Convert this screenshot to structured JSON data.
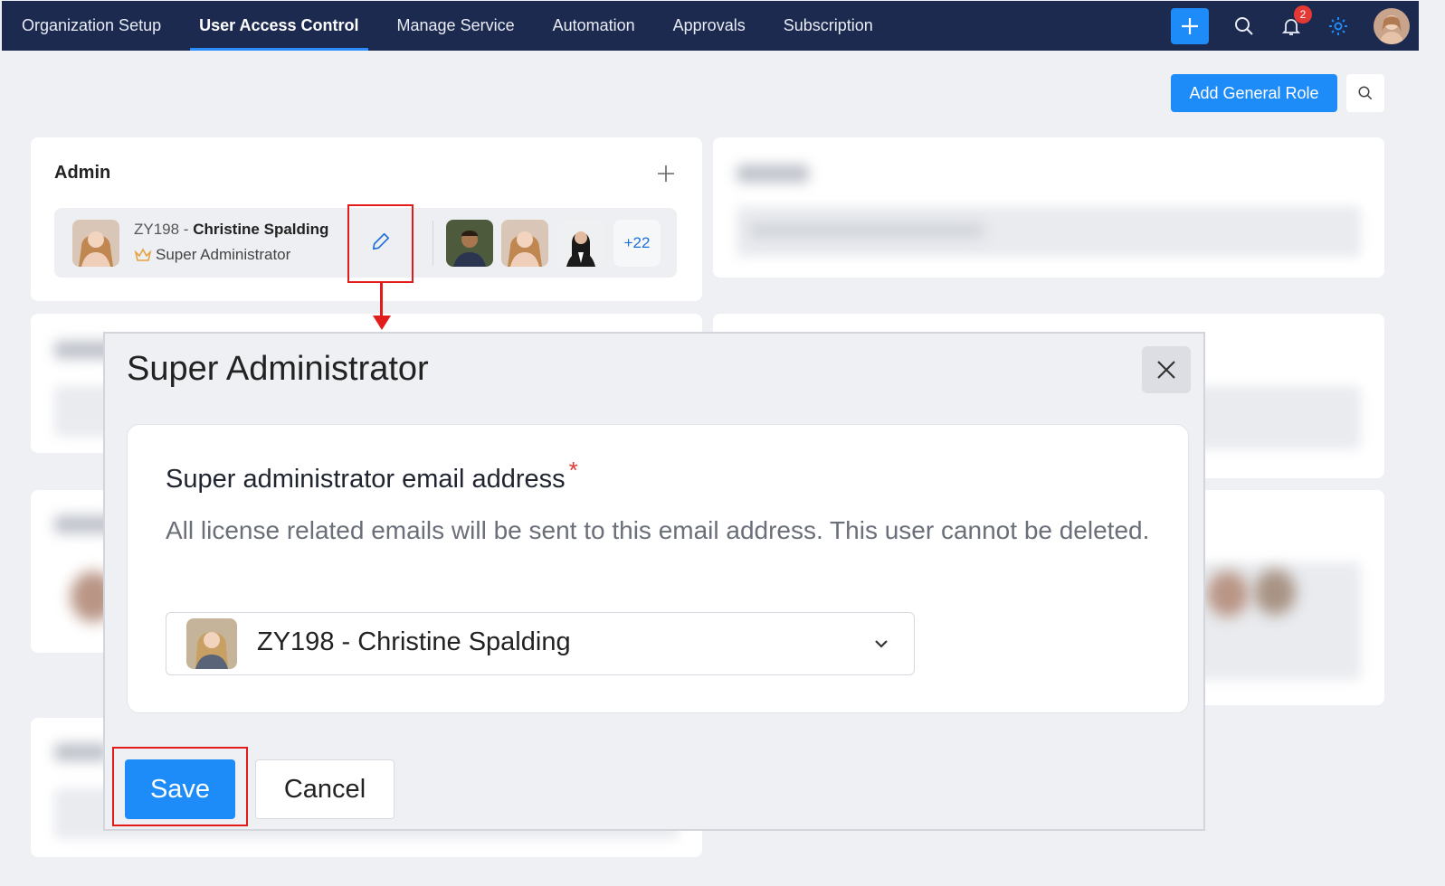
{
  "nav": {
    "tabs": [
      {
        "label": "Organization Setup"
      },
      {
        "label": "User Access Control"
      },
      {
        "label": "Manage Service"
      },
      {
        "label": "Automation"
      },
      {
        "label": "Approvals"
      },
      {
        "label": "Subscription"
      }
    ],
    "active_tab": "User Access Control",
    "notification_count": "2",
    "icons": [
      "plus-icon",
      "search-icon",
      "bell-icon",
      "gear-icon",
      "user-avatar"
    ],
    "accent_color": "#1d8cf8",
    "bar_color": "#1d2a4f"
  },
  "toolbar": {
    "add_role_label": "Add General Role"
  },
  "admin_card": {
    "title": "Admin",
    "primary_user": {
      "code": "ZY198 - ",
      "name": "Christine Spalding",
      "role": "Super Administrator"
    },
    "more_count": "+22"
  },
  "modal": {
    "title": "Super Administrator",
    "field_label": "Super administrator email address",
    "required_mark": "*",
    "description": "All license related emails will be sent to this email address. This user cannot be deleted.",
    "selected_user": "ZY198 - Christine Spalding",
    "save_label": "Save",
    "cancel_label": "Cancel"
  },
  "annotation_color": "#e21b1b"
}
